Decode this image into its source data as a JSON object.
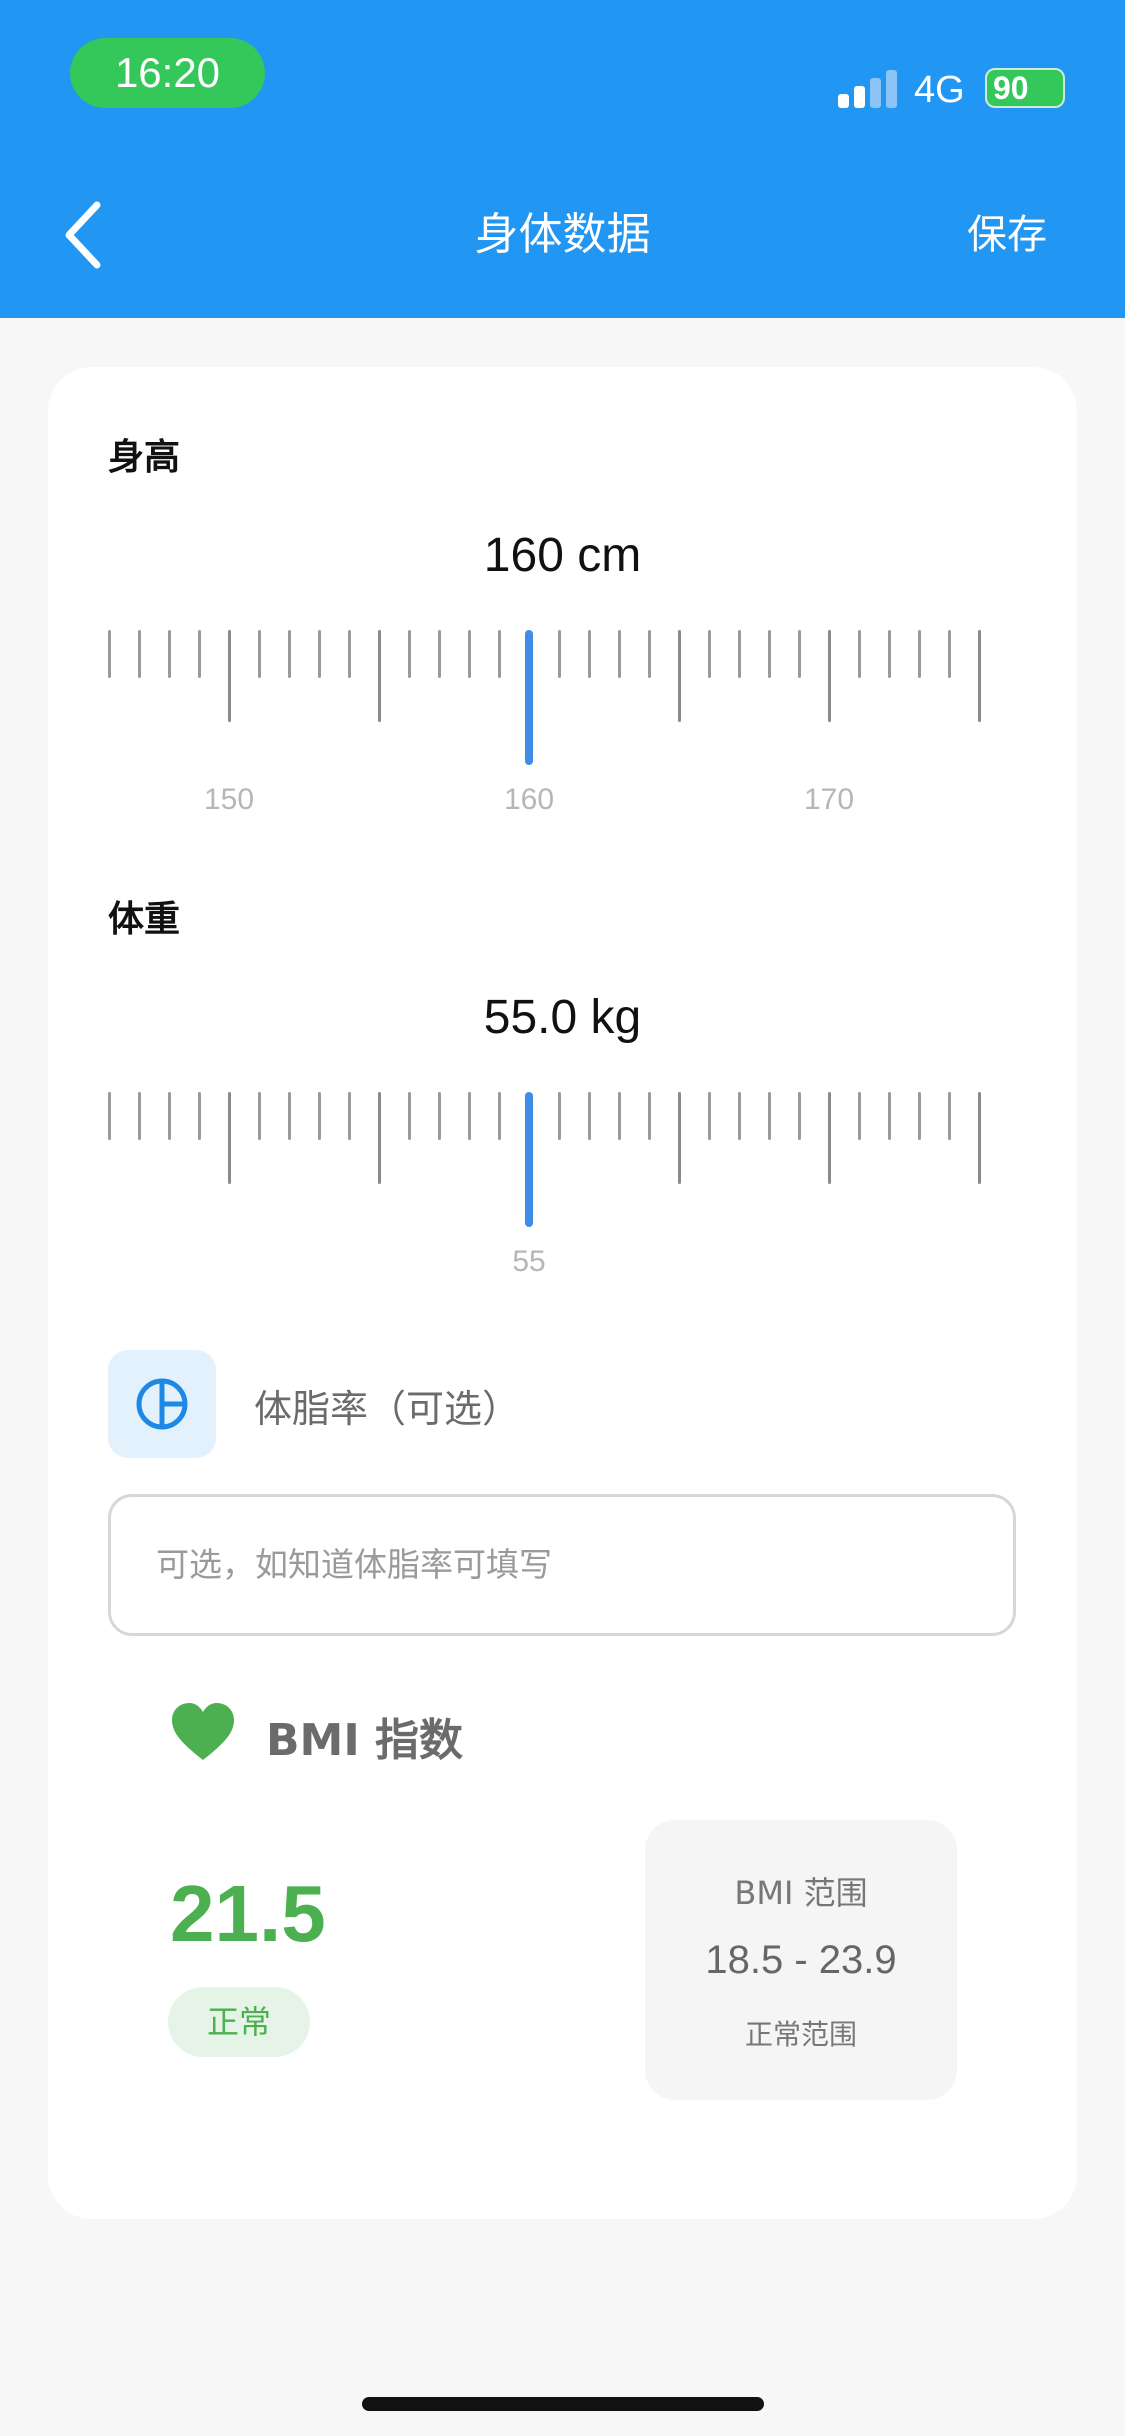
{
  "status_bar": {
    "time": "16:20",
    "network": "4G",
    "battery": "90"
  },
  "nav": {
    "title": "身体数据",
    "save": "保存"
  },
  "height": {
    "label": "身高",
    "value": "160 cm",
    "tick_labels": [
      "150",
      "160",
      "170"
    ]
  },
  "weight": {
    "label": "体重",
    "value": "55.0 kg",
    "tick_labels": [
      "55"
    ]
  },
  "body_fat": {
    "label": "体脂率（可选）",
    "placeholder": "可选，如知道体脂率可填写"
  },
  "bmi": {
    "title": "BMI 指数",
    "value": "21.5",
    "status": "正常",
    "range_title": "BMI 范围",
    "range_value": "18.5 - 23.9",
    "range_sub": "正常范围"
  },
  "colors": {
    "primary": "#2196f3",
    "accent_green": "#4caf50",
    "ruler_selected": "#3f8de6"
  },
  "icons": [
    "chevron-left-icon",
    "signal-icon",
    "battery-icon",
    "pie-chart-icon",
    "heart-icon"
  ]
}
